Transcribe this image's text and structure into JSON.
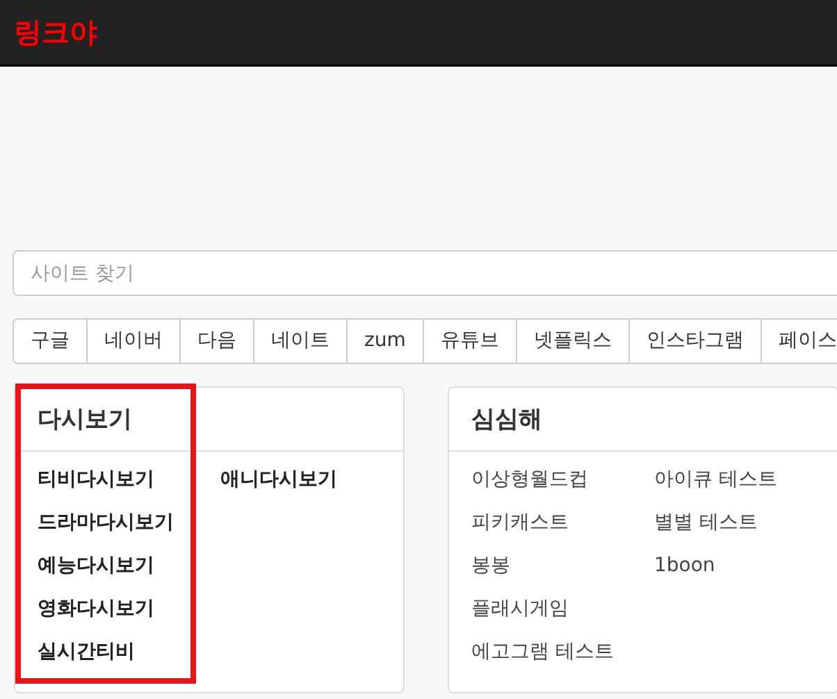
{
  "header": {
    "logo": "링크야"
  },
  "search": {
    "placeholder": "사이트 찾기"
  },
  "quick_links": [
    "구글",
    "네이버",
    "다음",
    "네이트",
    "zum",
    "유튜브",
    "넷플릭스",
    "인스타그램",
    "페이스"
  ],
  "cards": [
    {
      "title": "다시보기",
      "kind": "bold",
      "columns": [
        {
          "highlighted": true,
          "items": [
            "티비다시보기",
            "드라마다시보기",
            "예능다시보기",
            "영화다시보기",
            "실시간티비"
          ]
        },
        {
          "highlighted": false,
          "items": [
            "애니다시보기"
          ]
        }
      ]
    },
    {
      "title": "심심해",
      "kind": "plain",
      "columns": [
        {
          "highlighted": false,
          "items": [
            "이상형월드컵",
            "피키캐스트",
            "봉봉",
            "플래시게임",
            "에고그램 테스트"
          ]
        },
        {
          "highlighted": false,
          "items": [
            "아이큐 테스트",
            "별별 테스트",
            "1boon"
          ]
        }
      ]
    }
  ]
}
